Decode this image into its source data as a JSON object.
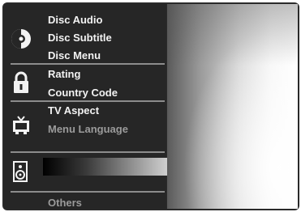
{
  "menu": {
    "disc": {
      "audio": "Disc Audio",
      "subtitle": "Disc Subtitle",
      "menu": "Disc Menu"
    },
    "lock": {
      "rating": "Rating",
      "country_code": "Country Code"
    },
    "display": {
      "tv_aspect": "TV Aspect",
      "menu_language": "Menu Language"
    },
    "others": "Others"
  },
  "icons": [
    "disc-icon",
    "padlock-icon",
    "tv-icon",
    "speaker-icon"
  ],
  "colors": {
    "menu_background": "#262626",
    "text": "#f2f2f2",
    "dim_text": "#9b9b9b",
    "separator": "#8c8c8c"
  }
}
